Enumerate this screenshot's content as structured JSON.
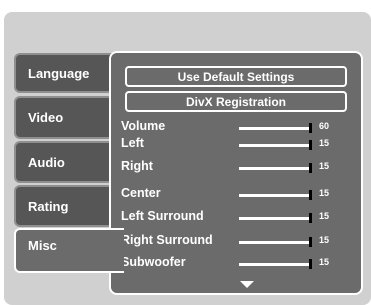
{
  "tabs": [
    {
      "label": "Language",
      "active": false
    },
    {
      "label": "Video",
      "active": false
    },
    {
      "label": "Audio",
      "active": false
    },
    {
      "label": "Rating",
      "active": false
    },
    {
      "label": "Misc",
      "active": true
    }
  ],
  "buttons": {
    "default_settings": "Use Default Settings",
    "divx_registration": "DivX Registration"
  },
  "settings": [
    {
      "label": "Volume",
      "value": "60"
    },
    {
      "label": "Left",
      "value": "15"
    },
    {
      "label": "Right",
      "value": "15"
    },
    {
      "label": "Center",
      "value": "15"
    },
    {
      "label": "Left Surround",
      "value": "15"
    },
    {
      "label": "Right Surround",
      "value": "15"
    },
    {
      "label": "Subwoofer",
      "value": "15"
    }
  ],
  "colors": {
    "panel": "#6b6b6b",
    "background": "#d0d0d0",
    "text": "#ffffff"
  },
  "icons": {
    "scroll": "triangle-down-icon"
  }
}
